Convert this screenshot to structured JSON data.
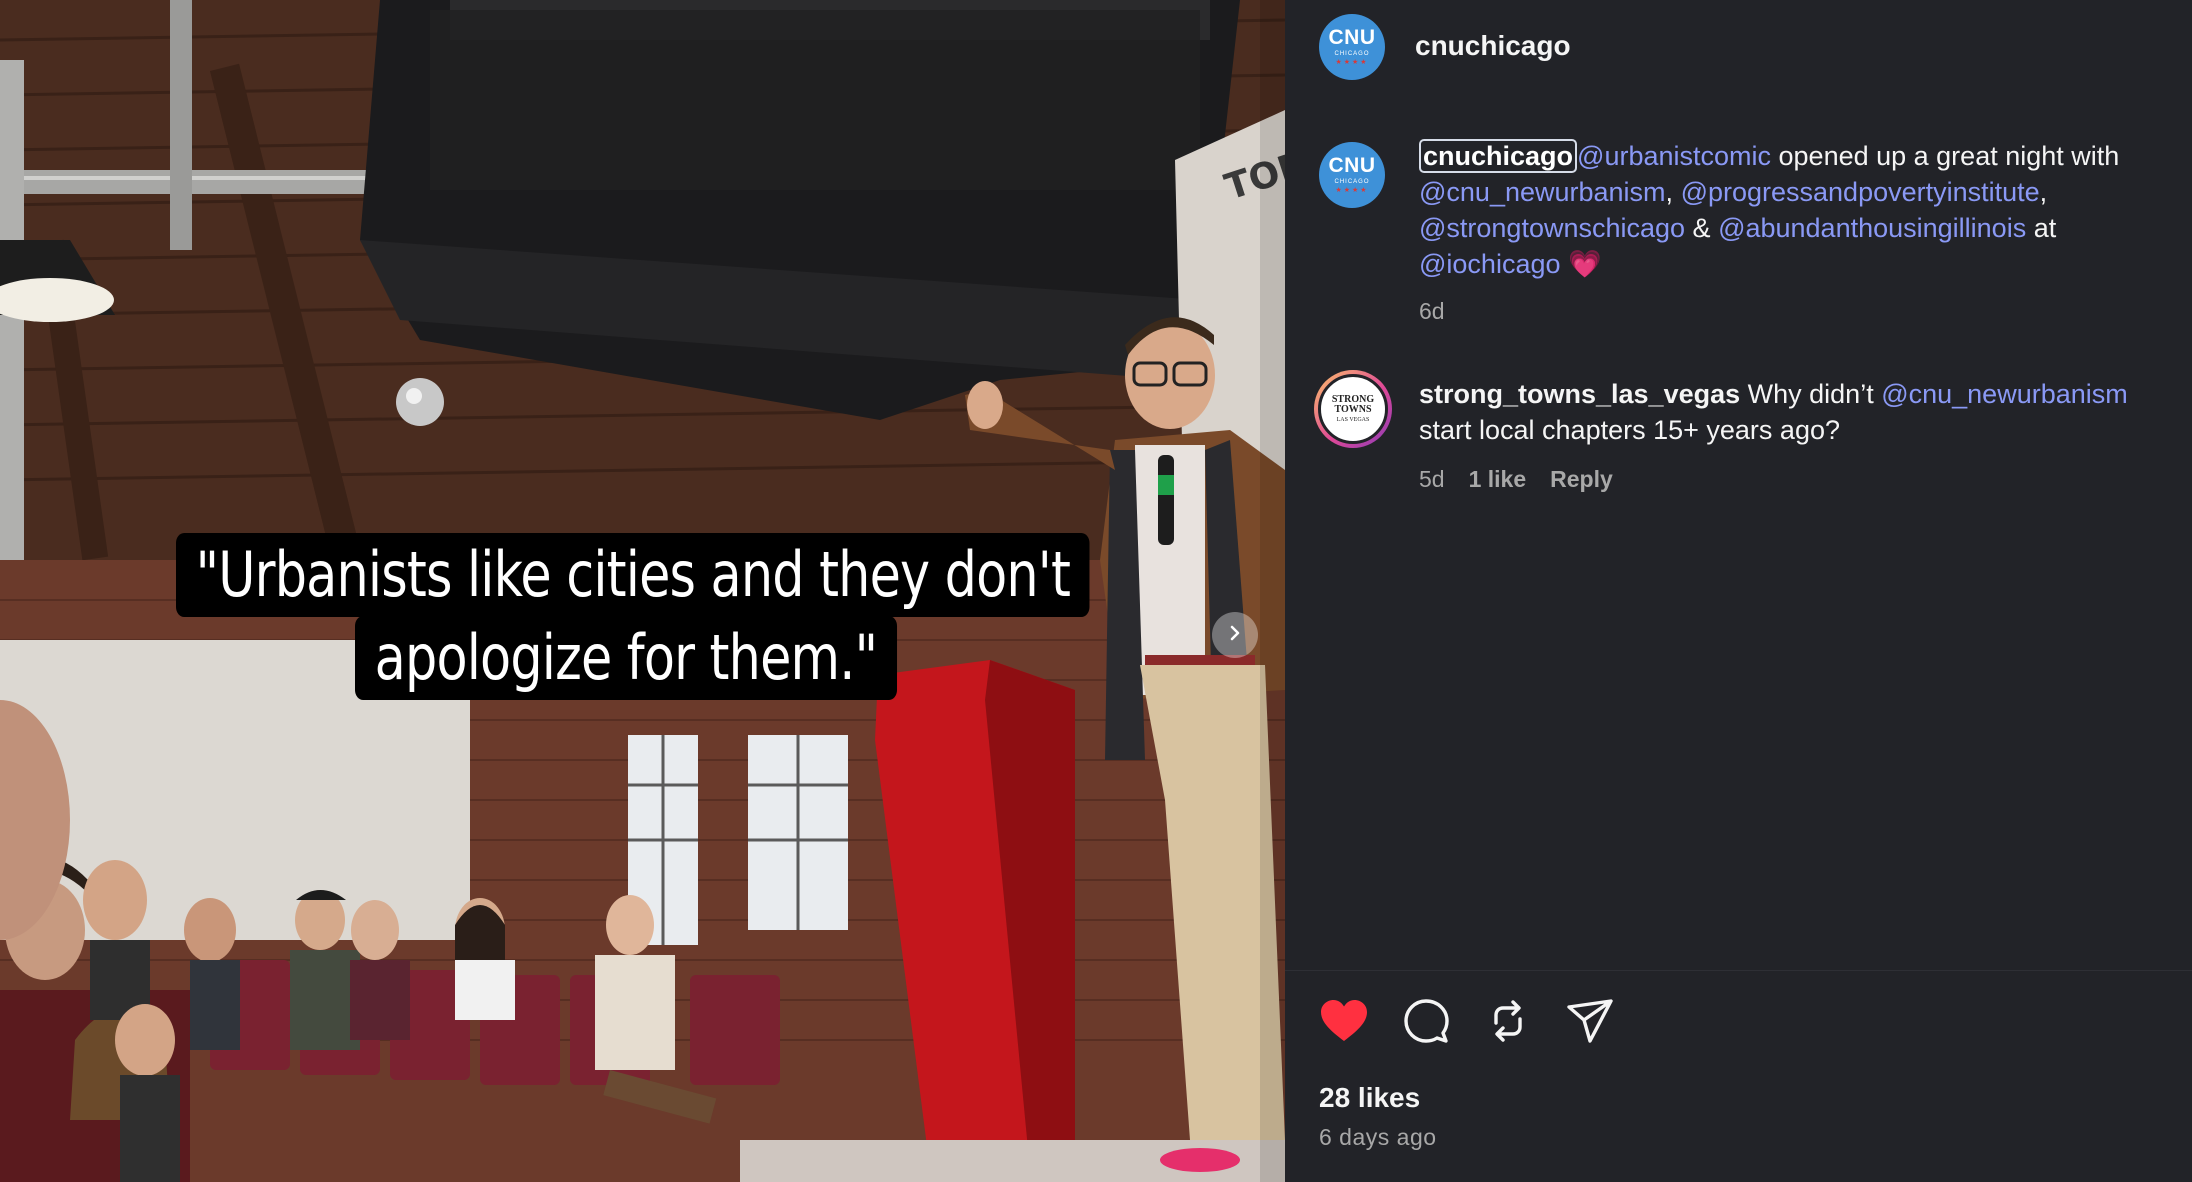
{
  "post": {
    "username": "cnuchicago",
    "avatar": {
      "main": "CNU",
      "sub": "CHICAGO",
      "stars": "★★★★"
    },
    "photo_caption": {
      "line1": "\"Urbanists like cities and they don't",
      "line2": "apologize for them.\""
    },
    "caption": {
      "username": "cnuchicago",
      "m1": "@urbanistcomic",
      "t1": " opened up a great night with ",
      "m2": "@cnu_newurbanism",
      "t2": ", ",
      "m3": "@progressandpovertyinstitute",
      "t3": ", ",
      "m4": "@strongtownschicago",
      "t4": " & ",
      "m5": "@abundanthousingillinois",
      "t5": " at ",
      "m6": "@iochicago",
      "emoji": "💗",
      "time": "6d"
    },
    "comment": {
      "username": "strong_towns_las_vegas",
      "text_before": " Why didn’t ",
      "mention": "@cnu_newurbanism",
      "text_after": " start local chapters 15+ years ago?",
      "time": "5d",
      "likes": "1 like",
      "reply": "Reply",
      "avatar_text": "STRONG TOWNS",
      "avatar_sub": "LAS VEGAS"
    },
    "likes": "28 likes",
    "age": "6 days ago"
  },
  "colors": {
    "panel_bg": "#222328",
    "mention": "#8a99f5",
    "like_heart": "#ff3040",
    "muted_text": "#a8a8a8",
    "avatar_blue": "#3e91d8"
  },
  "icons": [
    "heart-icon",
    "comment-icon",
    "repost-icon",
    "share-icon",
    "chevron-right-icon"
  ]
}
